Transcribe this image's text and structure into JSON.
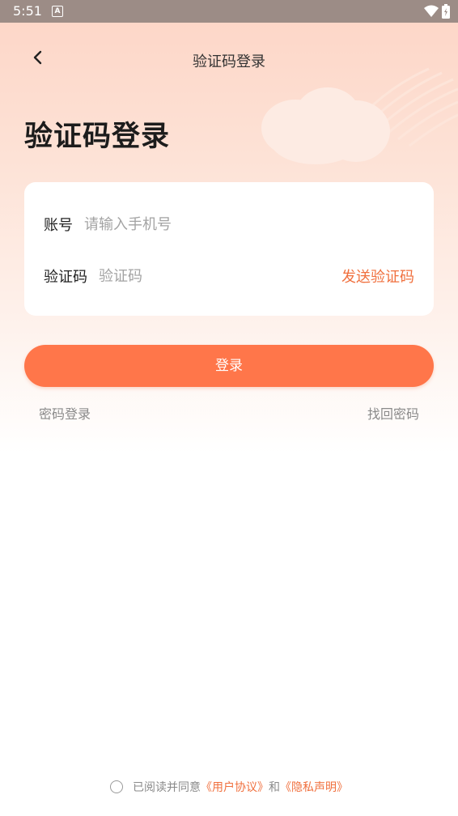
{
  "status_bar": {
    "time": "5:51",
    "notification_icon": "A"
  },
  "header": {
    "title": "验证码登录"
  },
  "page": {
    "heading": "验证码登录"
  },
  "form": {
    "account_label": "账号",
    "account_placeholder": "请输入手机号",
    "code_label": "验证码",
    "code_placeholder": "验证码",
    "send_code": "发送验证码"
  },
  "actions": {
    "login": "登录",
    "password_login": "密码登录",
    "recover_password": "找回密码"
  },
  "agreement": {
    "prefix": "已阅读并同意",
    "user_agreement": "《用户协议》",
    "conjunction": "和",
    "privacy": "《隐私声明》"
  },
  "colors": {
    "accent": "#ff764a",
    "link": "#f0703e"
  },
  "icons": {
    "back": "chevron-left-icon",
    "wifi": "wifi-icon",
    "battery": "battery-icon",
    "checkbox": "radio-circle-icon"
  }
}
